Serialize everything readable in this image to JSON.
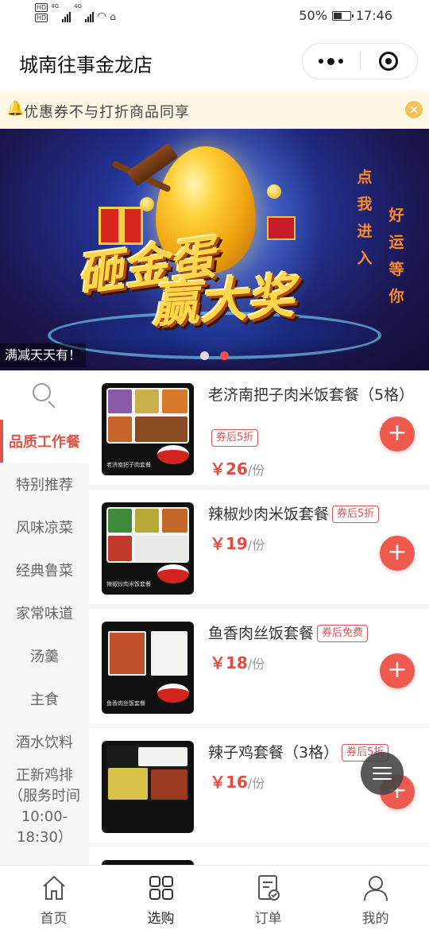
{
  "status_bar": {
    "network_badge_1": "HD",
    "network_badge_2": "HD",
    "signal_1": "4G",
    "signal_2": "4G",
    "battery_percent": "50%",
    "battery_level": 0.5,
    "time": "17:46"
  },
  "header": {
    "title": "城南往事金龙店"
  },
  "notice": {
    "text": "优惠券不与打折商品同享"
  },
  "banner": {
    "headline_1": "砸金蛋",
    "headline_2": "赢大奖",
    "side_text_1": "点我进入",
    "side_text_2": "好运等你",
    "caption": "满减天天有！",
    "dots_total": 2,
    "active_dot": 2
  },
  "categories": [
    {
      "label": "品质工作餐",
      "active": true
    },
    {
      "label": "特别推荐",
      "active": false
    },
    {
      "label": "风味凉菜",
      "active": false
    },
    {
      "label": "经典鲁菜",
      "active": false
    },
    {
      "label": "家常味道",
      "active": false
    },
    {
      "label": "汤羹",
      "active": false
    },
    {
      "label": "主食",
      "active": false
    },
    {
      "label": "酒水饮料",
      "active": false
    },
    {
      "label": "正新鸡排（服务时间10:00-18:30）",
      "active": false
    }
  ],
  "products": [
    {
      "name": "老济南把子肉米饭套餐（5格）",
      "tag": "券后5折",
      "price_symbol": "￥",
      "price": "26",
      "unit": "/份",
      "thumb_caption": "老济南把子肉套餐"
    },
    {
      "name": "辣椒炒肉米饭套餐",
      "tag": "券后5折",
      "price_symbol": "￥",
      "price": "19",
      "unit": "/份",
      "thumb_caption": "辣椒炒肉米饭套餐"
    },
    {
      "name": "鱼香肉丝饭套餐",
      "tag": "券后免费",
      "price_symbol": "￥",
      "price": "18",
      "unit": "/份",
      "thumb_caption": "鱼香肉丝饭套餐"
    },
    {
      "name": "辣子鸡套餐（3格）",
      "tag": "券后5折",
      "price_symbol": "￥",
      "price": "16",
      "unit": "/份",
      "thumb_caption": ""
    }
  ],
  "add_button_label": "+",
  "tabbar": [
    {
      "label": "首页",
      "icon": "home-icon",
      "active": false
    },
    {
      "label": "选购",
      "icon": "grid-icon",
      "active": true
    },
    {
      "label": "订单",
      "icon": "order-icon",
      "active": false
    },
    {
      "label": "我的",
      "icon": "profile-icon",
      "active": false
    }
  ],
  "colors": {
    "accent": "#e2544a",
    "notice_bg": "#fdf7e3",
    "add_button": "#ef5a4e"
  }
}
